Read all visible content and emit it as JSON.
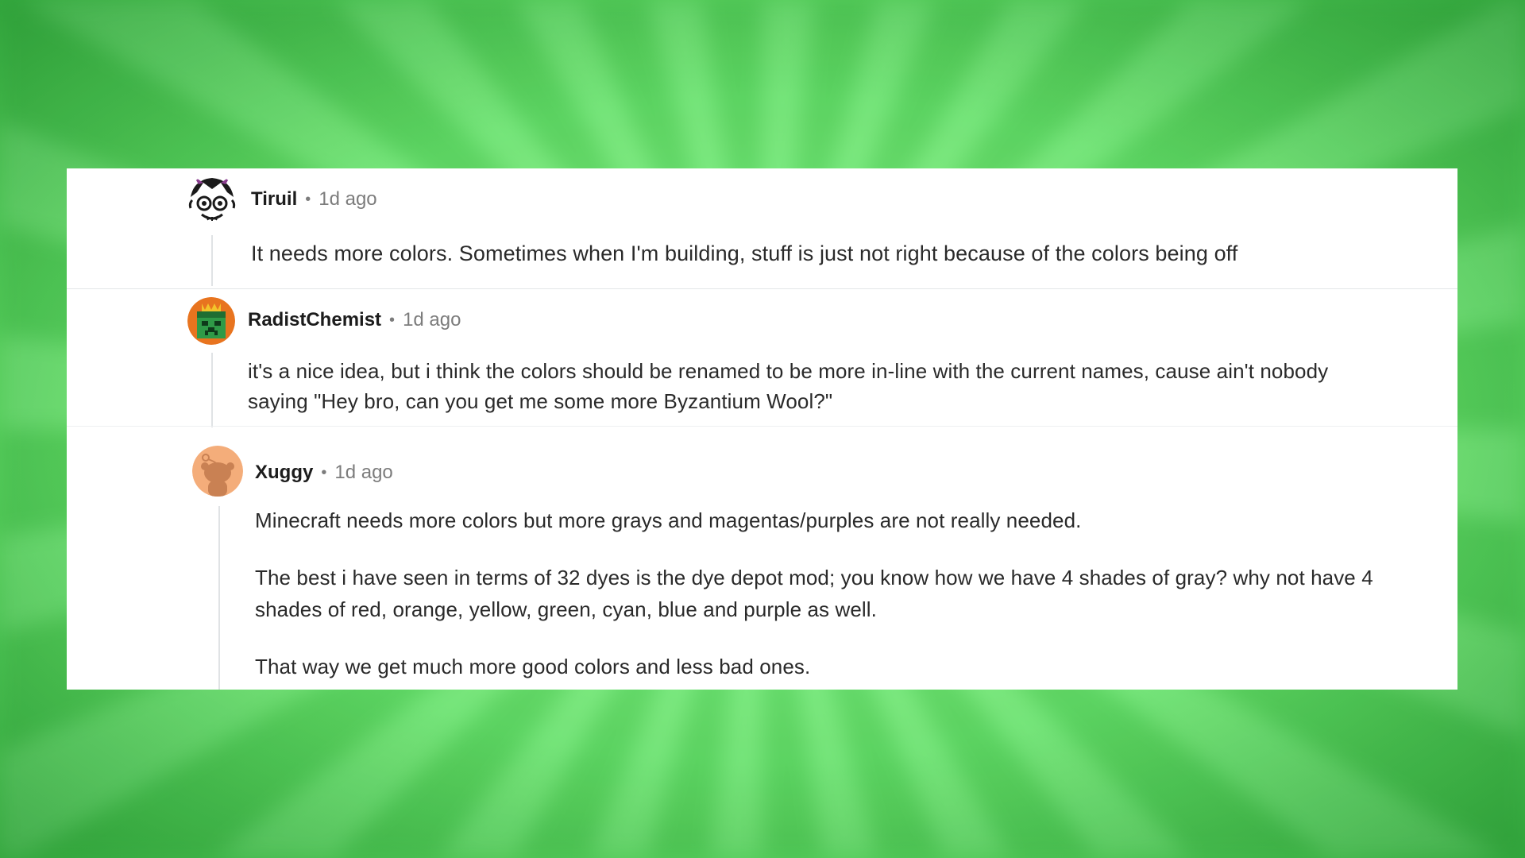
{
  "comments": [
    {
      "author": "Tiruil",
      "separator": "•",
      "time": "1d ago",
      "avatar_icon": "goblin-face-avatar",
      "paragraphs": [
        "It needs more colors. Sometimes when I'm building, stuff is just not right because of the colors being off"
      ]
    },
    {
      "author": "RadistChemist",
      "separator": "•",
      "time": "1d ago",
      "avatar_icon": "creeper-crown-avatar",
      "paragraphs": [
        "it's a nice idea, but i think the colors should be renamed to be more in-line with the current names, cause ain't nobody saying \"Hey bro, can you get me some more Byzantium Wool?\""
      ]
    },
    {
      "author": "Xuggy",
      "separator": "•",
      "time": "1d ago",
      "avatar_icon": "snoo-avatar",
      "paragraphs": [
        "Minecraft needs more colors but more grays and magentas/purples are not really needed.",
        "The best i have seen in terms of 32 dyes is the dye depot mod; you know how we have 4 shades of gray? why not have 4 shades of red, orange, yellow, green, cyan, blue and purple as well.",
        "That way we get much more good colors and less bad ones."
      ]
    }
  ],
  "colors": {
    "background_green": "#74ec78",
    "card": "#ffffff",
    "author_text": "#1c1c1c",
    "meta_text": "#7c7c7c",
    "body_text": "#2a2a2a"
  }
}
